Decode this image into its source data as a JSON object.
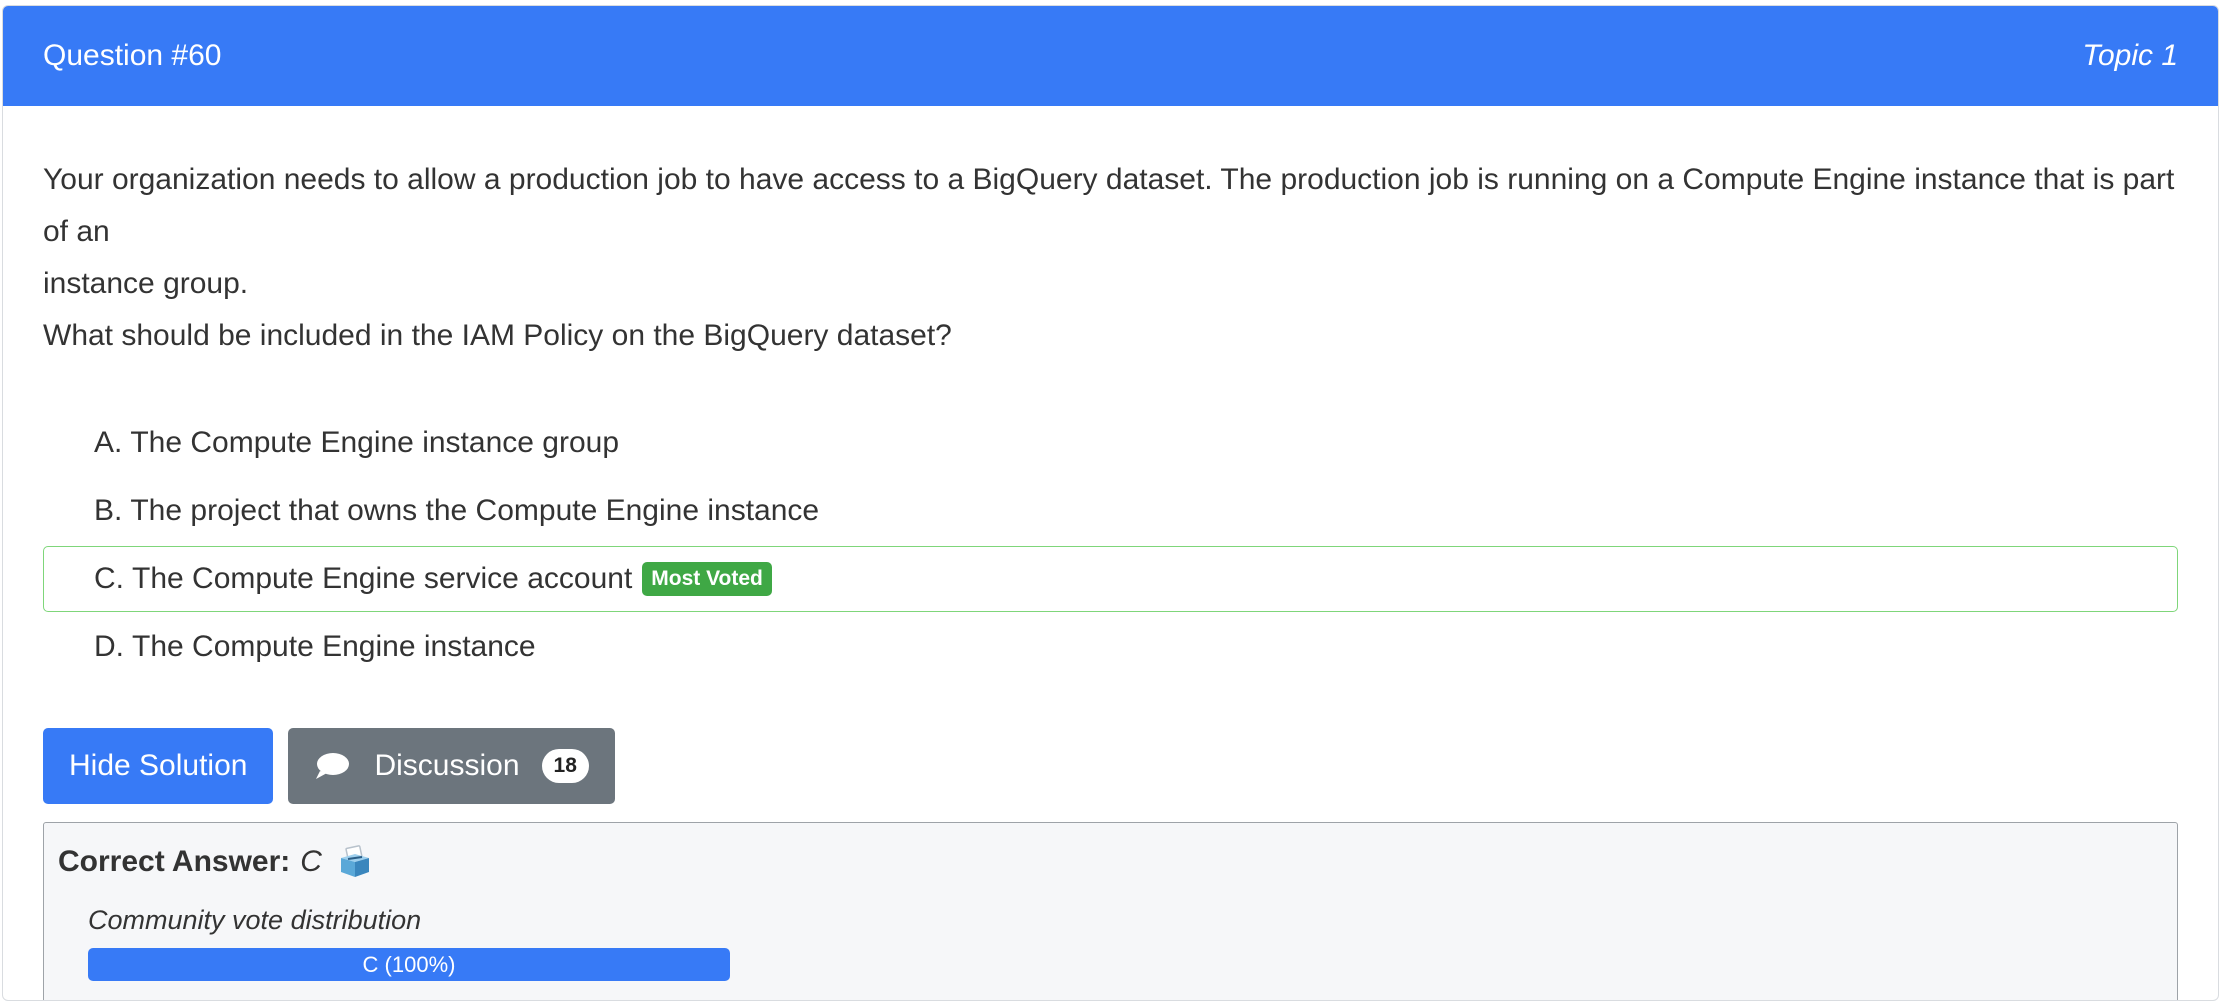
{
  "header": {
    "question_number": "Question #60",
    "topic": "Topic 1"
  },
  "question": {
    "text_line1": "Your organization needs to allow a production job to have access to a BigQuery dataset. The production job is running on a Compute Engine instance that is part of an",
    "text_line2": "instance group.",
    "text_line3": "What should be included in the IAM Policy on the BigQuery dataset?"
  },
  "choices": [
    {
      "letter": "A.",
      "text": "The Compute Engine instance group"
    },
    {
      "letter": "B.",
      "text": "The project that owns the Compute Engine instance"
    },
    {
      "letter": "C.",
      "text": "The Compute Engine service account",
      "badge": "Most Voted"
    },
    {
      "letter": "D.",
      "text": "The Compute Engine instance"
    }
  ],
  "buttons": {
    "hide_solution": "Hide Solution",
    "discussion": "Discussion",
    "discussion_count": "18"
  },
  "answer": {
    "label": "Correct Answer:",
    "value": "C",
    "icon": "ballot-box-icon"
  },
  "votes": {
    "title": "Community vote distribution",
    "bar_label": "C (100%)",
    "fraction": 1.0
  },
  "colors": {
    "primary": "#377af6",
    "secondary": "#6c757d",
    "success": "#3fa845",
    "voted_border": "#7fd67a"
  }
}
